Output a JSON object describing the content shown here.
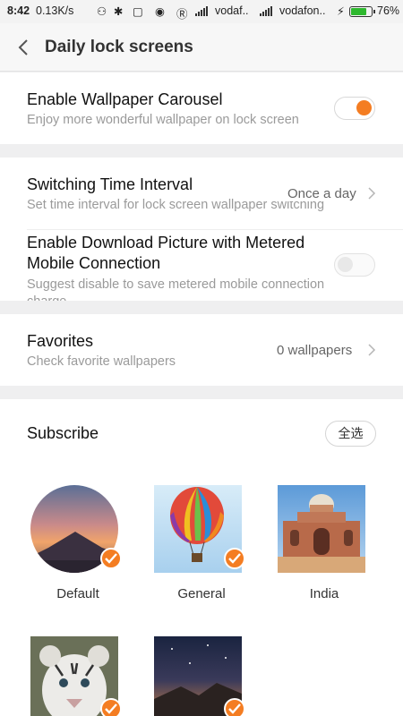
{
  "status_bar": {
    "time": "8:42",
    "speed": "0.13K/s",
    "carrier1": "vodaf..",
    "carrier2": "vodafon..",
    "battery": "76%"
  },
  "header": {
    "title": "Daily lock screens"
  },
  "carousel": {
    "title": "Enable Wallpaper Carousel",
    "subtitle": "Enjoy more wonderful wallpaper on lock screen",
    "enabled": true
  },
  "interval": {
    "title": "Switching Time Interval",
    "subtitle": "Set time interval for lock screen wallpaper switching",
    "value": "Once a day"
  },
  "metered": {
    "title_line1": "Enable Download Picture with Metered",
    "title_line2": "Mobile Connection",
    "subtitle_line1": "Suggest disable to save metered mobile connection",
    "subtitle_line2": "charge",
    "enabled": false
  },
  "favorites": {
    "title": "Favorites",
    "subtitle": "Check favorite wallpapers",
    "value": "0 wallpapers"
  },
  "subscribe": {
    "title": "Subscribe",
    "select_all": "全选",
    "items": [
      {
        "label": "Default",
        "selected": true
      },
      {
        "label": "General",
        "selected": true
      },
      {
        "label": "India",
        "selected": false
      },
      {
        "label": "",
        "selected": true
      },
      {
        "label": "",
        "selected": true
      }
    ]
  },
  "colors": {
    "accent": "#f47d22",
    "background": "#efeff0",
    "card": "#ffffff"
  }
}
